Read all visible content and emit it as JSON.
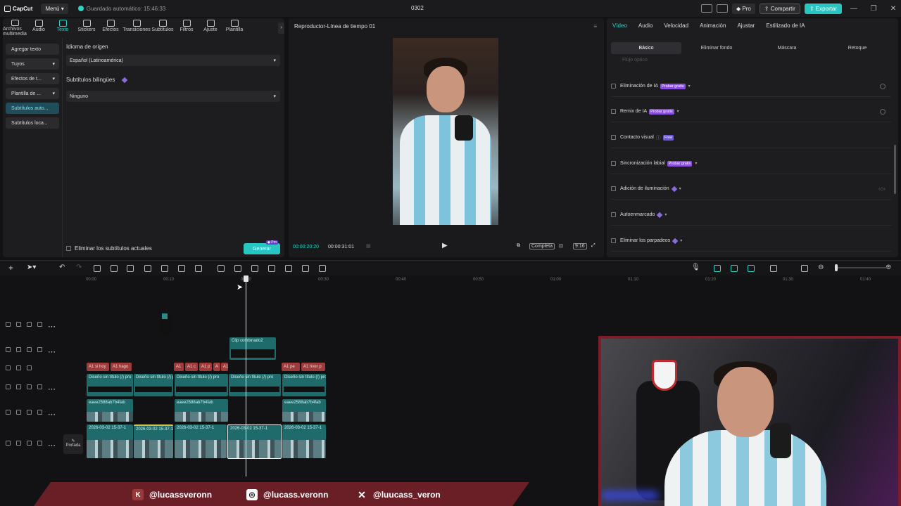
{
  "titlebar": {
    "logo": "CapCut",
    "menu": "Menú",
    "autosave": "Guardado automático: 15:46:33",
    "project": "0302",
    "pro": "Pro",
    "share": "Compartir",
    "export": "Exportar"
  },
  "tooltabs": [
    {
      "label": "Archivos multimedia",
      "icon": "media-icon"
    },
    {
      "label": "Audio",
      "icon": "audio-icon"
    },
    {
      "label": "Texto",
      "icon": "text-icon",
      "active": true
    },
    {
      "label": "Stickers",
      "icon": "sticker-icon"
    },
    {
      "label": "Efectos",
      "icon": "effects-icon"
    },
    {
      "label": "Transiciones",
      "icon": "transition-icon"
    },
    {
      "label": "Subtítulos",
      "icon": "subtitles-icon"
    },
    {
      "label": "Filtros",
      "icon": "filter-icon"
    },
    {
      "label": "Ajuste",
      "icon": "adjust-icon"
    },
    {
      "label": "Plantilla",
      "icon": "template-icon"
    }
  ],
  "sidecats": [
    "Agregar texto",
    "Tuyos",
    "Efectos de t...",
    "Plantilla de ...",
    "Subtítulos auto...",
    "Subtítulos loca..."
  ],
  "captions": {
    "source_lang_label": "Idioma de origen",
    "source_lang_value": "Español (Latinoamérica)",
    "bilingual_label": "Subtítulos bilingües",
    "bilingual_value": "Ninguno",
    "clear_label": "Eliminar los subtítulos actuales",
    "generate": "Generar",
    "pro_badge": "Pro"
  },
  "player": {
    "title": "Reproductor-Línea de tiempo 01",
    "current": "00:00:20:20",
    "total": "00:00:31:01",
    "full": "Completa",
    "ratio": "9:16"
  },
  "rightpanel": {
    "tabs": [
      "Vídeo",
      "Audio",
      "Velocidad",
      "Animación",
      "Ajustar",
      "Estilizado de IA"
    ],
    "subtabs": [
      "Básico",
      "Eliminar fondo",
      "Máscara",
      "Retoque"
    ],
    "partial": "Flujo óptico",
    "items": [
      {
        "label": "Eliminación de IA",
        "badge": "Probar gratis"
      },
      {
        "label": "Remix de IA",
        "badge": "Probar gratis"
      },
      {
        "label": "Contacto visual",
        "badge": "Free"
      },
      {
        "label": "Sincronización labial",
        "badge": "Probar gratis"
      },
      {
        "label": "Adición de iluminación",
        "badge": ""
      },
      {
        "label": "Autoenmarcado",
        "badge": ""
      },
      {
        "label": "Eliminar los parpadeos",
        "badge": ""
      }
    ]
  },
  "timeline": {
    "ticks": [
      "00:00",
      "00:10",
      "00:20",
      "00:30",
      "00:40",
      "00:50",
      "01:00",
      "01:10",
      "01:20",
      "01:30",
      "01:40"
    ],
    "cover": "Portada",
    "combined": "Clip combinado2",
    "design": "Diseño sin título (/) pro",
    "hash": "eaee2588ab7b4fab",
    "datestamp": "2026-03-02 15-37-1",
    "caps": [
      "A1 si hoy",
      "A1 hago",
      "A1",
      "A1 c",
      "A1 p",
      "A",
      "A1",
      "A1 pe",
      "A1 river p"
    ]
  },
  "socials": [
    "@lucassveronn",
    "@lucass.veronn",
    "@luucass_veron"
  ]
}
